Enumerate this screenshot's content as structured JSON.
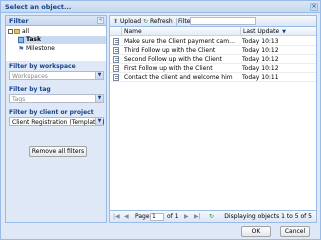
{
  "window": {
    "title": "Select an object..."
  },
  "left_panel": {
    "header": "Filter",
    "tree": {
      "root": "all",
      "items": [
        "Task",
        "Milestone"
      ]
    },
    "filters": [
      {
        "label": "Filter by workspace",
        "value": "Workspaces",
        "placeholder": true
      },
      {
        "label": "Filter by tag",
        "value": "Tags",
        "placeholder": true
      },
      {
        "label": "Filter by client or project",
        "value": "Client Registration (Templates)",
        "placeholder": false
      }
    ],
    "remove_button": "Remove all filters"
  },
  "toolbar": {
    "upload": "Upload",
    "refresh": "Refresh",
    "filter_label": "Filter:"
  },
  "grid": {
    "columns": {
      "name": "Name",
      "last_update": "Last Update"
    },
    "rows": [
      {
        "name": "Make sure the Client payment came through...",
        "last_update": "Today 10:13"
      },
      {
        "name": "Third Follow up with the Client",
        "last_update": "Today 10:12"
      },
      {
        "name": "Second Follow up with the Client",
        "last_update": "Today 10:12"
      },
      {
        "name": "First Follow up with the Client",
        "last_update": "Today 10:12"
      },
      {
        "name": "Contact the client and welcome him",
        "last_update": "Today 10:11"
      }
    ]
  },
  "pager": {
    "page_label": "Page",
    "page_value": "1",
    "of_label": "of 1",
    "display": "Displaying objects 1 to 5 of 5"
  },
  "footer": {
    "ok": "OK",
    "cancel": "Cancel"
  }
}
